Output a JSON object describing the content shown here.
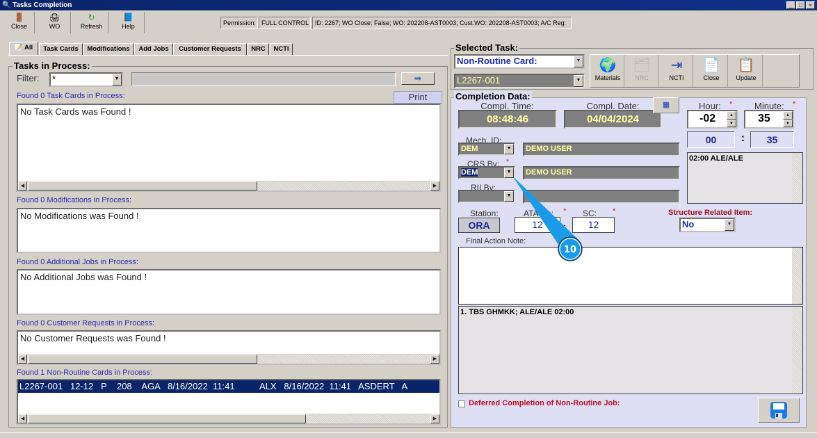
{
  "window": {
    "title": "Tasks Completion",
    "controls": [
      "_",
      "□",
      "×"
    ]
  },
  "toolbar": {
    "buttons": [
      {
        "label": "Close",
        "icon": "exit-door-icon"
      },
      {
        "label": "WO",
        "icon": "printer-icon"
      },
      {
        "label": "Refresh",
        "icon": "refresh-icon"
      },
      {
        "label": "Help",
        "icon": "help-book-icon"
      }
    ],
    "permission_label": "Permission:",
    "permission_value": "FULL CONTROL",
    "info": "ID: 2267; WO Close: False; WO: 202208-AST0003; Cust.WO: 202208-AST0003; A/C Reg:"
  },
  "tabs": [
    "All",
    "Task Cards",
    "Modifications",
    "Add Jobs",
    "Customer Requests",
    "NRC",
    "NCTI"
  ],
  "left": {
    "title": "Tasks in Process:",
    "filter_label": "Filter:",
    "filter_value": "*",
    "print_label": "Print",
    "sections": [
      {
        "label": "Found 0 Task Cards in Process:",
        "content": "No Task Cards was Found !"
      },
      {
        "label": "Found 0 Modifications in Process:",
        "content": "No Modifications was Found !"
      },
      {
        "label": "Found 0 Additional Jobs in Process:",
        "content": "No Additional Jobs was Found !"
      },
      {
        "label": "Found 0 Customer Requests in Process:",
        "content": "No Customer Requests was Found !"
      },
      {
        "label": "Found 1 Non-Routine Cards in Process:",
        "content": "L2267-001   12-12   P    208    AGA   8/16/2022  11:41          ALX   8/16/2022  11:41   ASDERT   A"
      }
    ]
  },
  "selected_task": {
    "title": "Selected Task:",
    "type": "Non-Routine Card:",
    "card": "L2267-001",
    "buttons": [
      {
        "label": "Materials",
        "enabled": true
      },
      {
        "label": "NRC",
        "enabled": false
      },
      {
        "label": "NCTI",
        "enabled": true
      },
      {
        "label": "Close",
        "enabled": true
      },
      {
        "label": "Update",
        "enabled": true
      }
    ]
  },
  "completion": {
    "title": "Completion Data:",
    "time_label": "Compl. Time:",
    "time": "08:48:46",
    "date_label": "Compl. Date:",
    "date": "04/04/2024",
    "hour_label": "Hour:",
    "hour": "-02",
    "minute_label": "Minute:",
    "minute": "35",
    "dur_hours": "00",
    "dur_sep": ":",
    "dur_minutes": "35",
    "mech_label": "Mech. ID:",
    "mech_id": "DEM",
    "mech_name": "DEMO USER",
    "crs_label": "CRS By:",
    "crs_id": "DEM",
    "crs_name": "DEMO USER",
    "rii_label": "RII By:",
    "rii_id": "",
    "rii_name": "",
    "notes": "02:00  ALE/ALE",
    "station_label": "Station:",
    "station": "ORA",
    "ata_label": "ATA Ch:",
    "ata": "12",
    "dash": "-",
    "sc_label": "SC:",
    "sc": "12",
    "sri_label": "Structure Related Item:",
    "sri": "No",
    "final_note_label": "Final Action Note:",
    "final_note": "",
    "history": "1. TBS GHMKK; ALE/ALE  02:00",
    "deferred_label": "Deferred Completion of Non-Routine Job:",
    "deferred": false,
    "required": "*"
  },
  "callout": {
    "number": "10",
    "color": "#1a9be8"
  }
}
